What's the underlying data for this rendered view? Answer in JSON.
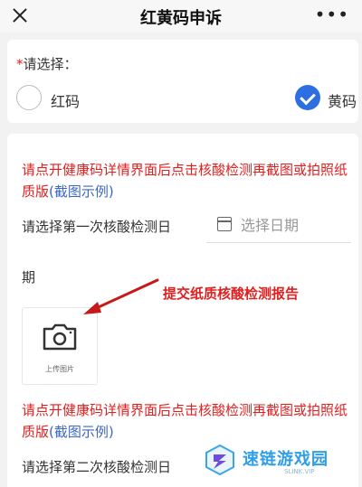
{
  "header": {
    "title": "红黄码申诉",
    "more_icon": "more-icon"
  },
  "selection": {
    "label": "请选择：",
    "required_mark": "*",
    "options": [
      {
        "label": "红码",
        "selected": false
      },
      {
        "label": "黄码",
        "selected": true
      }
    ]
  },
  "first_test": {
    "notice_main": "请点开健康码详情界面后点击核酸检测再截图或拍照纸质版",
    "notice_link": "(截图示例)",
    "date_label_line1": "请选择第一次核酸检测日",
    "date_label_line2": "期",
    "date_placeholder": "选择日期",
    "upload_label": "上传图片"
  },
  "annotation": "提交纸质核酸检测报告",
  "second_test": {
    "notice_main": "请点开健康码详情界面后点击核酸检测再截图或拍照纸质版",
    "notice_link": "(截图示例)",
    "date_label_line1": "请选择第二次核酸检测日"
  },
  "watermark": {
    "text": "速链游戏园",
    "sub": "SLINK.VIP"
  },
  "colors": {
    "accent_blue": "#2d6fe0",
    "notice_red": "#e01f1f",
    "link_blue": "#3a67c8"
  }
}
